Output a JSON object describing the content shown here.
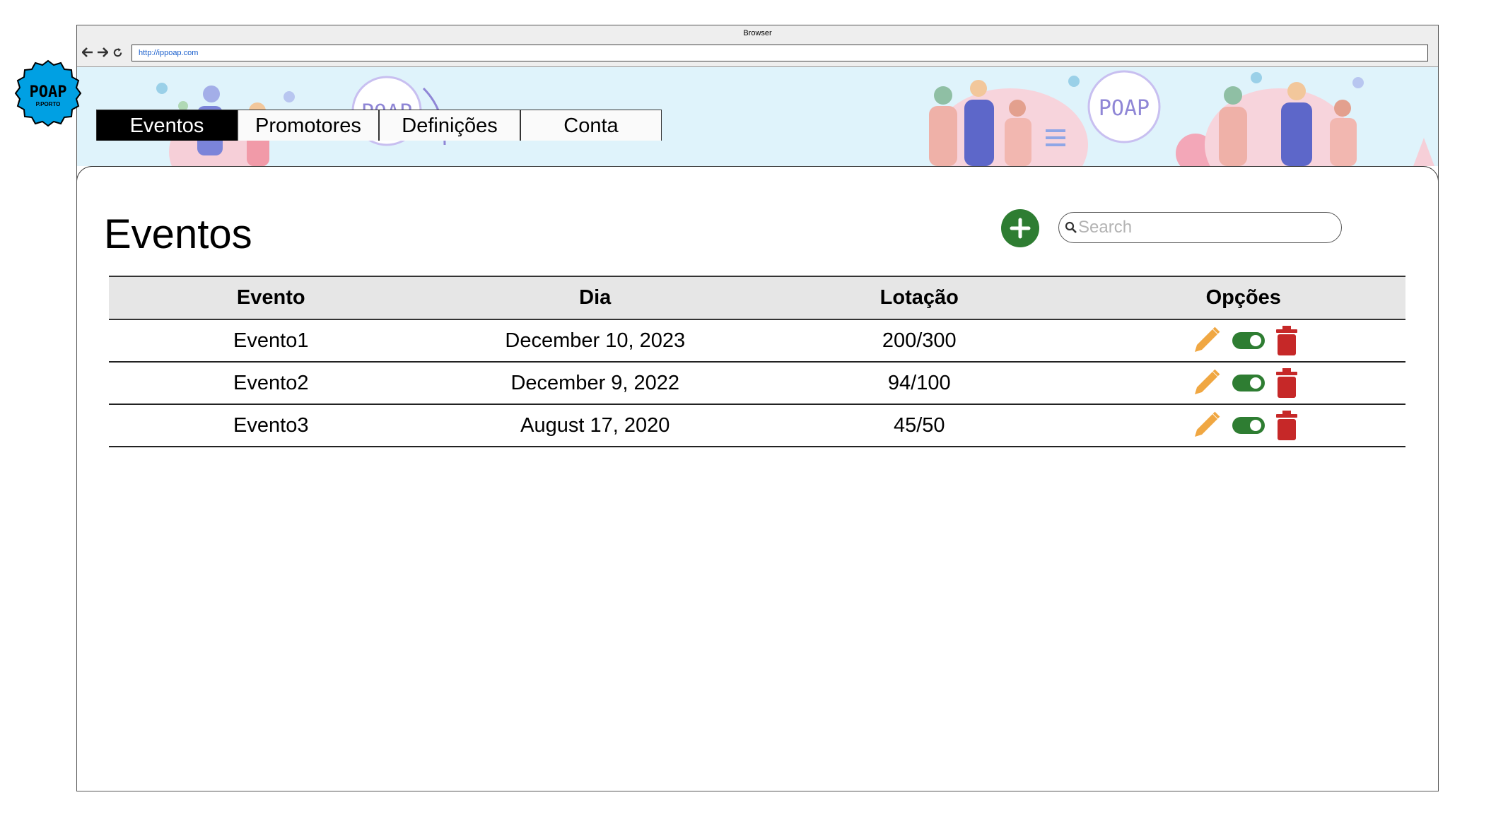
{
  "browser": {
    "title": "Browser",
    "url": "http://ippoap.com"
  },
  "logo": {
    "text": "POAP",
    "subtext": "P.PORTO"
  },
  "banner": {
    "mark_text": "POAP"
  },
  "nav": {
    "tabs": [
      {
        "label": "Eventos",
        "active": true
      },
      {
        "label": "Promotores",
        "active": false
      },
      {
        "label": "Definições",
        "active": false
      },
      {
        "label": "Conta",
        "active": false
      }
    ]
  },
  "page": {
    "title": "Eventos",
    "search_placeholder": "Search"
  },
  "table": {
    "columns": [
      "Evento",
      "Dia",
      "Lotação",
      "Opções"
    ],
    "rows": [
      {
        "evento": "Evento1",
        "dia": "December 10, 2023",
        "lotacao": "200/300",
        "enabled": true
      },
      {
        "evento": "Evento2",
        "dia": "December 9, 2022",
        "lotacao": "94/100",
        "enabled": true
      },
      {
        "evento": "Evento3",
        "dia": "August 17, 2020",
        "lotacao": "45/50",
        "enabled": true
      }
    ]
  },
  "colors": {
    "add": "#2e7d32",
    "edit": "#f0a742",
    "toggle": "#2e7d32",
    "delete": "#c62828",
    "active_tab": "#000000",
    "banner_bg": "#dff3fb",
    "logo": "#00a0e3"
  },
  "icons": {
    "add": "plus-icon",
    "search": "search-icon",
    "edit": "pencil-icon",
    "toggle": "toggle-icon",
    "delete": "trash-icon"
  }
}
